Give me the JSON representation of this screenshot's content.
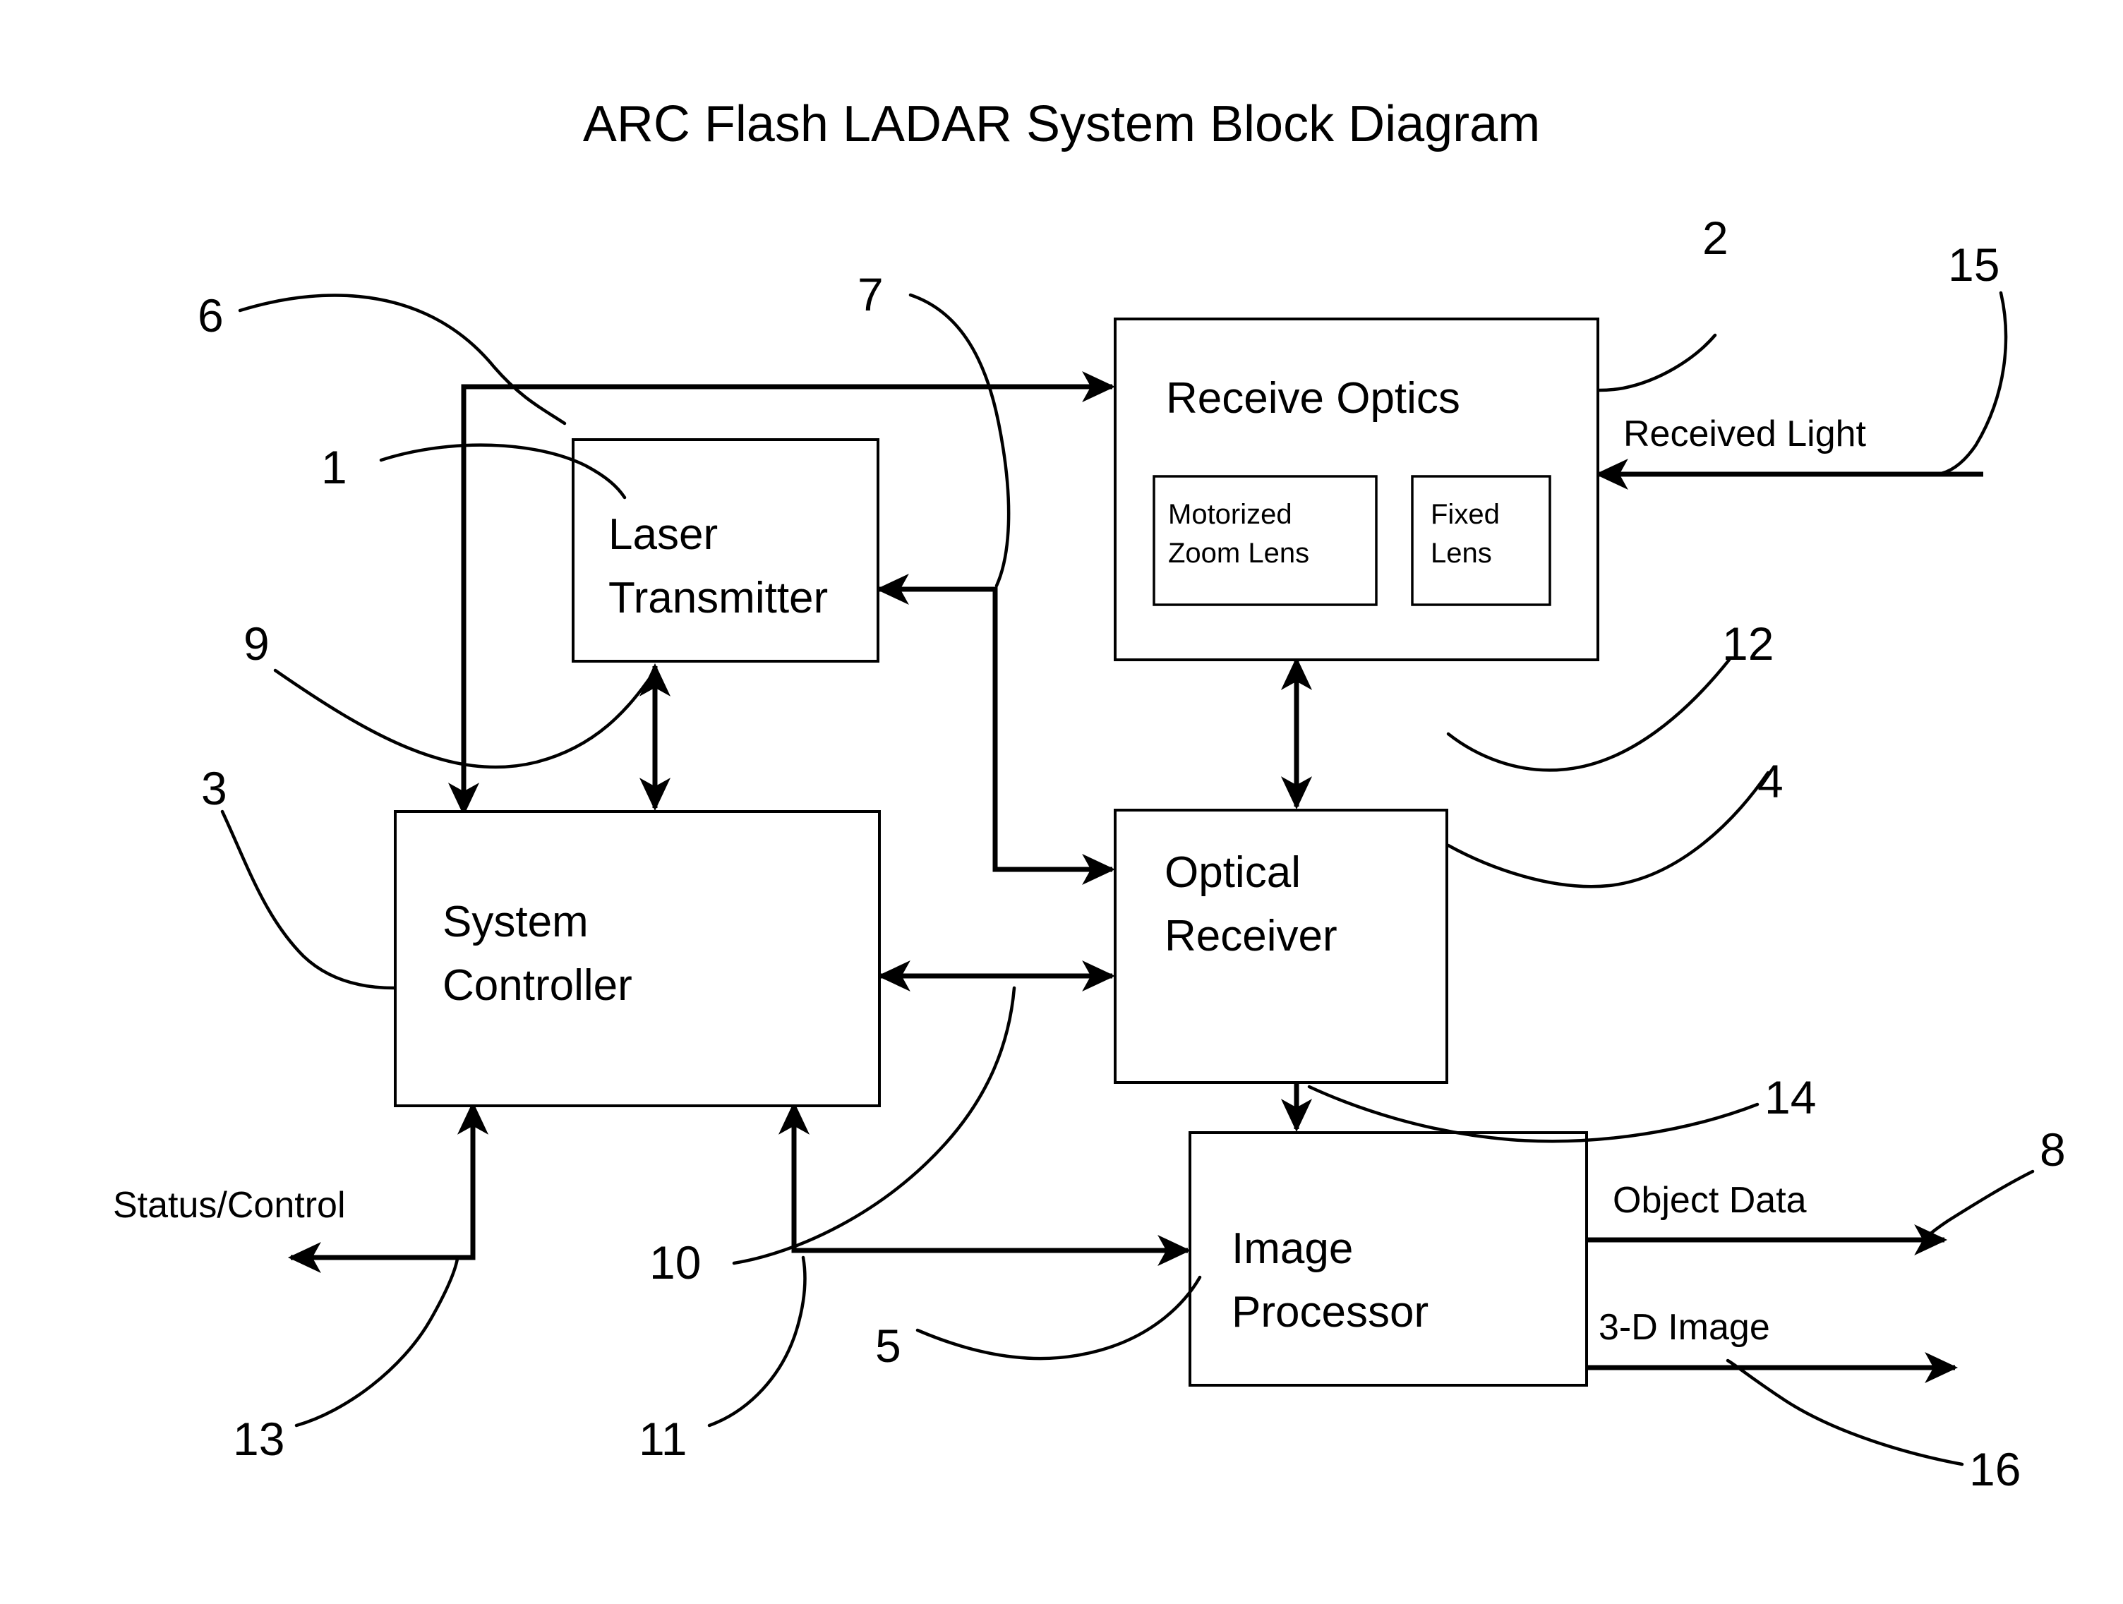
{
  "title": "ARC Flash LADAR System Block Diagram",
  "blocks": {
    "laser_transmitter": {
      "line1": "Laser",
      "line2": "Transmitter"
    },
    "receive_optics": {
      "label": "Receive Optics"
    },
    "motorized_zoom_lens": {
      "line1": "Motorized",
      "line2": "Zoom Lens"
    },
    "fixed_lens": {
      "line1": "Fixed",
      "line2": "Lens"
    },
    "system_controller": {
      "line1": "System",
      "line2": "Controller"
    },
    "optical_receiver": {
      "line1": "Optical",
      "line2": "Receiver"
    },
    "image_processor": {
      "line1": "Image",
      "line2": "Processor"
    }
  },
  "io_labels": {
    "received_light": "Received Light",
    "status_control": "Status/Control",
    "object_data": "Object Data",
    "three_d_image": "3-D Image"
  },
  "reference_numerals": {
    "n1": "1",
    "n2": "2",
    "n3": "3",
    "n4": "4",
    "n5": "5",
    "n6": "6",
    "n7": "7",
    "n8": "8",
    "n9": "9",
    "n10": "10",
    "n11": "11",
    "n12": "12",
    "n13": "13",
    "n14": "14",
    "n15": "15",
    "n16": "16"
  },
  "colors": {
    "stroke": "#000000",
    "background": "#ffffff"
  }
}
